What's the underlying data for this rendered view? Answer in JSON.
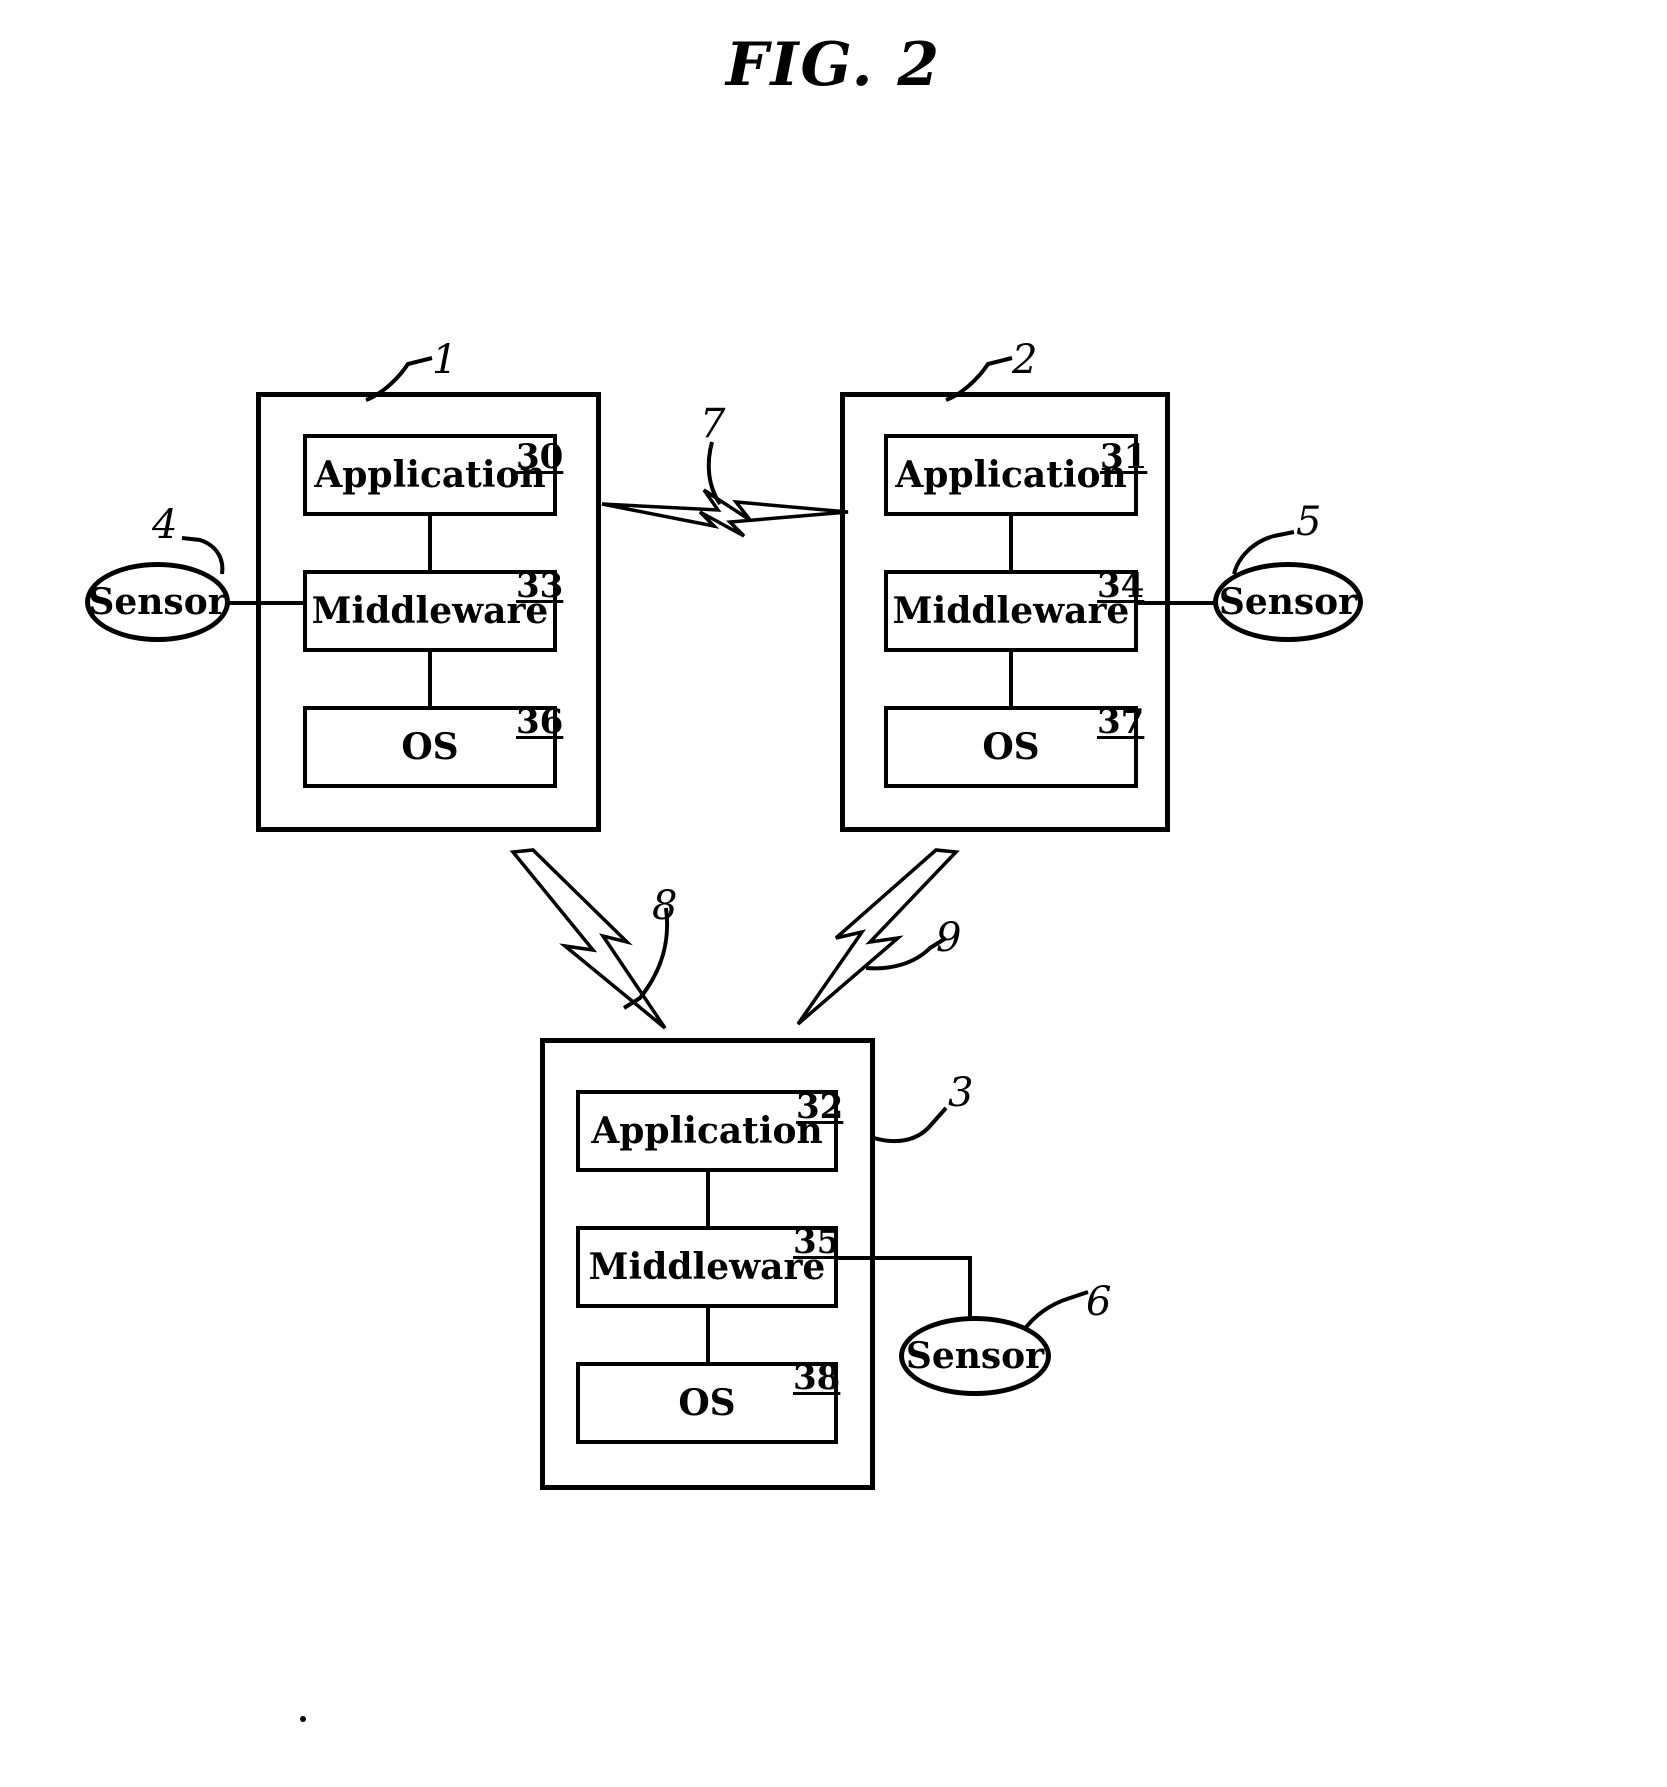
{
  "figure": {
    "title": "FIG. 2",
    "type": "patent-block-diagram"
  },
  "devices": [
    {
      "id": "device-1",
      "ref": "1",
      "layers": [
        {
          "label": "Application",
          "ref": "30"
        },
        {
          "label": "Middleware",
          "ref": "33"
        },
        {
          "label": "OS",
          "ref": "36"
        }
      ]
    },
    {
      "id": "device-2",
      "ref": "2",
      "layers": [
        {
          "label": "Application",
          "ref": "31"
        },
        {
          "label": "Middleware",
          "ref": "34"
        },
        {
          "label": "OS",
          "ref": "37"
        }
      ]
    },
    {
      "id": "device-3",
      "ref": "3",
      "layers": [
        {
          "label": "Application",
          "ref": "32"
        },
        {
          "label": "Middleware",
          "ref": "35"
        },
        {
          "label": "OS",
          "ref": "38"
        }
      ]
    }
  ],
  "sensors": [
    {
      "id": "sensor-4",
      "label": "Sensor",
      "ref": "4",
      "attached_to": "device-1"
    },
    {
      "id": "sensor-5",
      "label": "Sensor",
      "ref": "5",
      "attached_to": "device-2"
    },
    {
      "id": "sensor-6",
      "label": "Sensor",
      "ref": "6",
      "attached_to": "device-3"
    }
  ],
  "links": [
    {
      "id": "link-7",
      "ref": "7",
      "from": "device-1",
      "to": "device-2",
      "kind": "wireless"
    },
    {
      "id": "link-8",
      "ref": "8",
      "from": "device-1",
      "to": "device-3",
      "kind": "wireless"
    },
    {
      "id": "link-9",
      "ref": "9",
      "from": "device-2",
      "to": "device-3",
      "kind": "wireless"
    }
  ]
}
